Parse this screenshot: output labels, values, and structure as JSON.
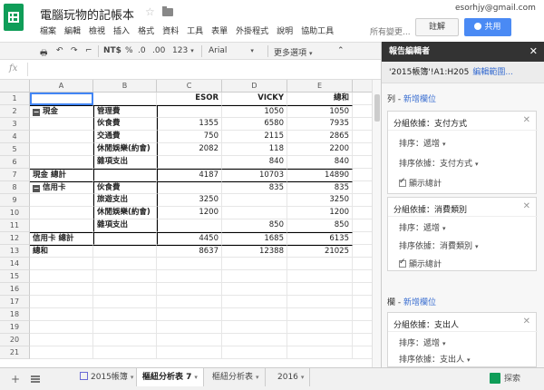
{
  "header": {
    "title": "電腦玩物的記帳本",
    "email": "esorhjy@gmail.com",
    "saved": "所有變更...",
    "comments_label": "註解",
    "share_label": "共用",
    "menu": [
      "檔案",
      "編輯",
      "檢視",
      "插入",
      "格式",
      "資料",
      "工具",
      "表單",
      "外掛程式",
      "說明",
      "協助工具"
    ]
  },
  "toolbar": {
    "currency": "NT$",
    "percent": "%",
    "dec_decrease": ".0",
    "dec_increase": ".00",
    "format_more": "123",
    "font": "Arial",
    "more": "更多選項",
    "collapse": "⌃"
  },
  "formula": {
    "fx": "fx"
  },
  "grid": {
    "columns": [
      "A",
      "B",
      "C",
      "D",
      "E"
    ],
    "rows": [
      "1",
      "2",
      "3",
      "4",
      "5",
      "6",
      "7",
      "8",
      "9",
      "10",
      "11",
      "12",
      "13",
      "14",
      "15",
      "16",
      "17",
      "18",
      "19",
      "20",
      "21"
    ],
    "cells": {
      "C1": "ESOR",
      "D1": "VICKY",
      "E1": "總和",
      "A2": "現金",
      "B2": "管理費",
      "D2": "1050",
      "E2": "1050",
      "B3": "伙食費",
      "C3": "1355",
      "D3": "6580",
      "E3": "7935",
      "B4": "交通費",
      "C4": "750",
      "D4": "2115",
      "E4": "2865",
      "B5": "休閒娛樂(約會)",
      "C5": "2082",
      "D5": "118",
      "E5": "2200",
      "B6": "雜項支出",
      "D6": "840",
      "E6": "840",
      "A7": "現金 總計",
      "C7": "4187",
      "D7": "10703",
      "E7": "14890",
      "A8": "信用卡",
      "B8": "伙食費",
      "D8": "835",
      "E8": "835",
      "B9": "旅遊支出",
      "C9": "3250",
      "E9": "3250",
      "B10": "休閒娛樂(約會)",
      "C10": "1200",
      "E10": "1200",
      "B11": "雜項支出",
      "D11": "850",
      "E11": "850",
      "A12": "信用卡 總計",
      "C12": "4450",
      "D12": "1685",
      "E12": "6135",
      "A13": "總和",
      "C13": "8637",
      "D13": "12388",
      "E13": "21025"
    }
  },
  "sheets": {
    "tabs": [
      "2015帳簿",
      "樞紐分析表 7",
      "樞紐分析表",
      "2016"
    ],
    "active": 1,
    "explore_label": "探索"
  },
  "panel": {
    "title": "報告編輯者",
    "range": "'2015帳簿'!A1:H205",
    "edit_range": "編輯範圍...",
    "rows_label": "列",
    "rows_add": "新增欄位",
    "cols_label": "欄",
    "cols_add": "新增欄位",
    "group1": {
      "title": "分組依據：支付方式",
      "sort": "排序：遞增",
      "sort_by": "排序依據：支付方式",
      "show_totals": "顯示總計"
    },
    "group2": {
      "title": "分組依據：消費類別",
      "sort": "排序：遞增",
      "sort_by": "排序依據：消費類別",
      "show_totals": "顯示總計"
    },
    "group3": {
      "title": "分組依據：支出人",
      "sort": "排序：遞增",
      "sort_by": "排序依據：支出人"
    }
  }
}
